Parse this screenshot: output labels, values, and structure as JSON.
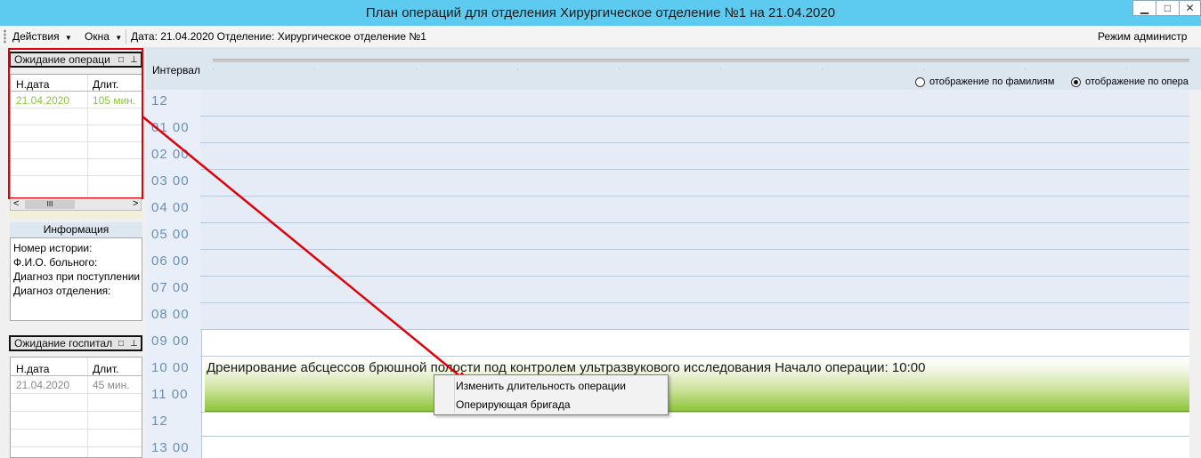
{
  "window": {
    "title": "План операций для отделения Хирургическое отделение №1 на 21.04.2020",
    "minimize_glyph": "▁",
    "maximize_glyph": "□",
    "close_glyph": "✕"
  },
  "toolbar": {
    "actions_label": "Действия",
    "windows_label": "Окна",
    "date_info": "Дата: 21.04.2020 Отделение: Хирургическое отделение №1",
    "mode_label": "Режим администр"
  },
  "waiting_operation": {
    "title": "Ожидание операци",
    "columns": [
      "Н.дата",
      "Длит."
    ],
    "rows": [
      {
        "date": "21.04.2020",
        "duration": "105 мин."
      }
    ]
  },
  "scrollbar": {
    "left_arrow": "<",
    "thumb_glyph": "III",
    "right_arrow": ">"
  },
  "info": {
    "title": "Информация",
    "lines": [
      "Номер истории:",
      "Ф.И.О. больного:",
      "Диагноз при поступлении",
      "Диагноз отделения:"
    ]
  },
  "waiting_hospital": {
    "title": "Ожидание госпитал",
    "columns": [
      "Н.дата",
      "Длит."
    ],
    "rows": [
      {
        "date": "21.04.2020",
        "duration": "45 мин."
      }
    ]
  },
  "schedule": {
    "interval_label": "Интервал",
    "view_options": [
      {
        "label": "отображение по фамилиям",
        "selected": false
      },
      {
        "label": "отображение по опера",
        "selected": true
      }
    ],
    "hours": [
      "12",
      "01  00",
      "02  00",
      "03  00",
      "04  00",
      "05  00",
      "06  00",
      "07  00",
      "08  00",
      "09  00",
      "10  00",
      "11  00",
      "12",
      "13  00"
    ],
    "operation_text": "Дренирование абсцессов брюшной полости под контролем ультразвукового исследования Начало операции: 10:00"
  },
  "context_menu": {
    "items": [
      "Изменить длительность операции",
      "Оперирующая бригада"
    ]
  },
  "colors": {
    "titlebar": "#5ccbef",
    "highlight": "#e0000a",
    "row_text_green": "#8bc53f",
    "row_text_gray": "#8a8a8a",
    "hour_text": "#6c8fb4",
    "night_bg": "#e6ecf5",
    "operation_green": "#8dc43a"
  }
}
